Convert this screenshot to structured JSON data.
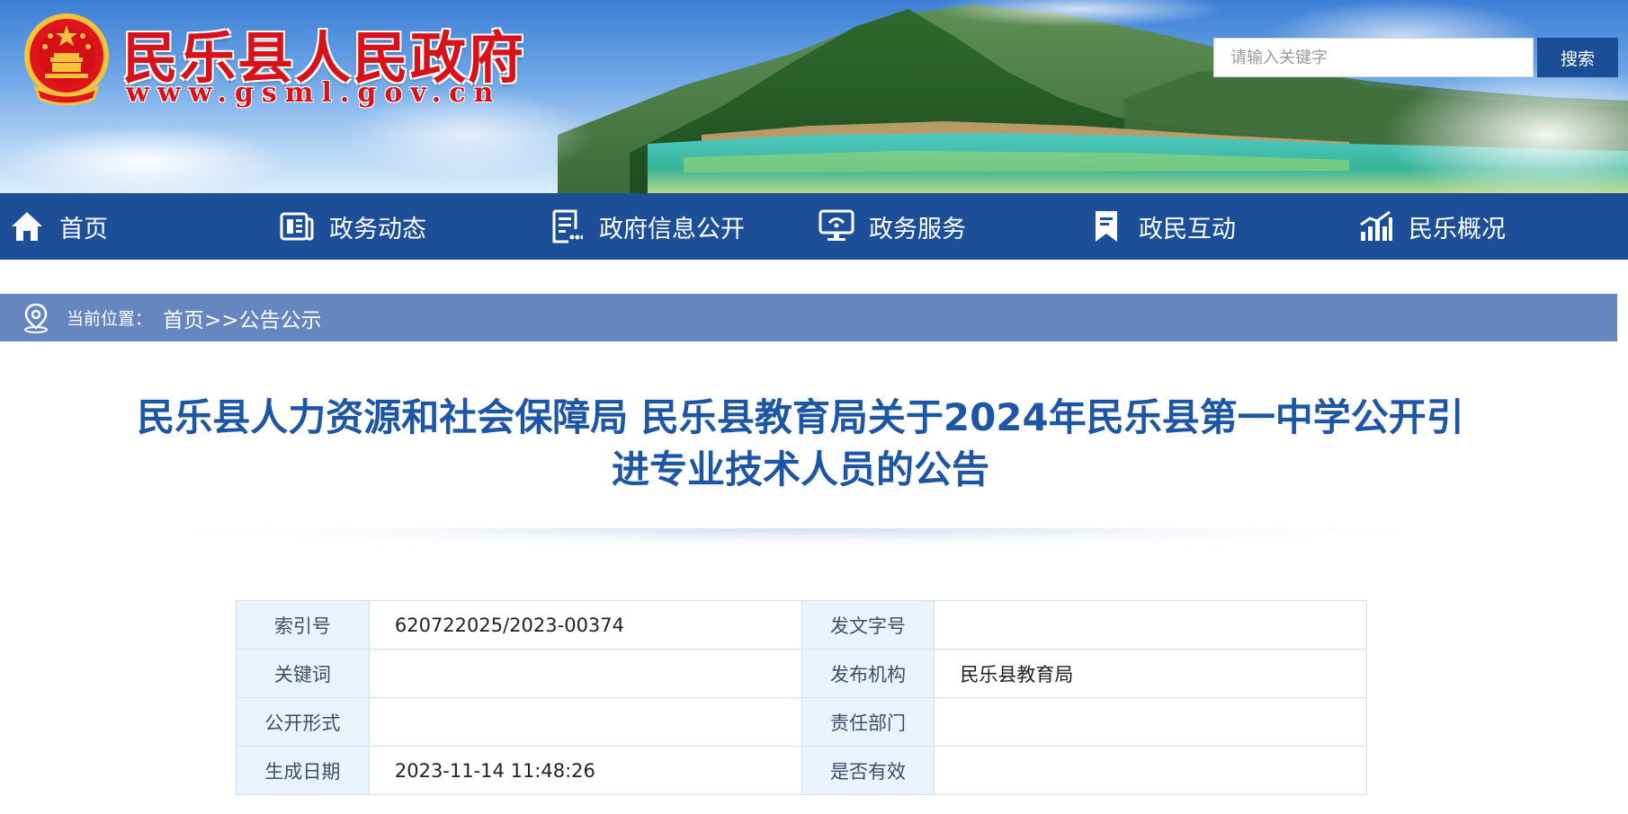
{
  "header": {
    "site_title": "民乐县人民政府",
    "site_url": "www.gsml.gov.cn",
    "search_placeholder": "请输入关键字",
    "search_button": "搜索"
  },
  "nav": [
    {
      "label": "首页",
      "icon": "home-icon"
    },
    {
      "label": "政务动态",
      "icon": "newspaper-icon"
    },
    {
      "label": "政府信息公开",
      "icon": "document-list-icon"
    },
    {
      "label": "政务服务",
      "icon": "monitor-service-icon"
    },
    {
      "label": "政民互动",
      "icon": "bookmark-icon"
    },
    {
      "label": "民乐概况",
      "icon": "bar-chart-icon"
    }
  ],
  "breadcrumb": {
    "label": "当前位置：",
    "path": "首页>>公告公示"
  },
  "article": {
    "title_line1": "民乐县人力资源和社会保障局 民乐县教育局关于2024年民乐县第一中学公开引",
    "title_line2": "进专业技术人员的公告"
  },
  "info_table": [
    {
      "k1": "索引号",
      "v1": "620722025/2023-00374",
      "k2": "发文字号",
      "v2": ""
    },
    {
      "k1": "关键词",
      "v1": "",
      "k2": "发布机构",
      "v2": "民乐县教育局"
    },
    {
      "k1": "公开形式",
      "v1": "",
      "k2": "责任部门",
      "v2": ""
    },
    {
      "k1": "生成日期",
      "v1": "2023-11-14 11:48:26",
      "k2": "是否有效",
      "v2": ""
    }
  ],
  "colors": {
    "nav_bg": "#1c4f97",
    "breadcrumb_bg": "#6586bf",
    "title_color": "#1e56a6",
    "brand_red": "#d8121a"
  }
}
